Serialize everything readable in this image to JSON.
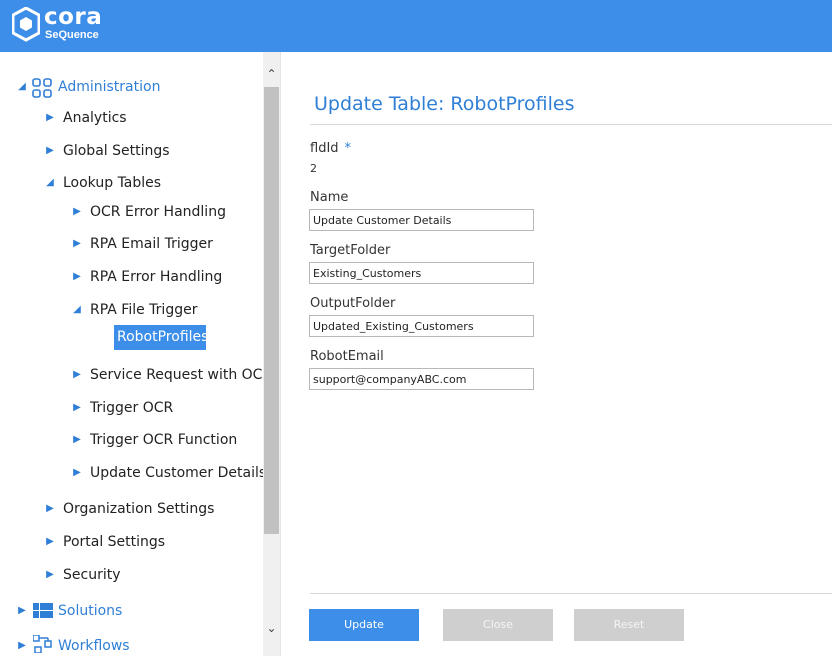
{
  "brand": {
    "name": "cora",
    "sub": "SeQuence"
  },
  "sidebar": {
    "administration": "Administration",
    "analytics": "Analytics",
    "global_settings": "Global Settings",
    "lookup_tables": "Lookup Tables",
    "ocr_error": "OCR Error Handling",
    "rpa_email": "RPA Email Trigger",
    "rpa_error": "RPA Error Handling",
    "rpa_file": "RPA File Trigger",
    "robot_profiles": "RobotProfiles",
    "service_request": "Service Request with OCR",
    "trigger_ocr": "Trigger OCR",
    "trigger_ocr_fn": "Trigger OCR Function",
    "update_customer": "Update Customer Details wi",
    "org_settings": "Organization Settings",
    "portal_settings": "Portal Settings",
    "security": "Security",
    "solutions": "Solutions",
    "workflows": "Workflows"
  },
  "form": {
    "title": "Update Table: RobotProfiles",
    "fldid_label": "fldId",
    "required_mark": "*",
    "fldid_value": "2",
    "name_label": "Name",
    "name_value": "Update Customer Details",
    "target_label": "TargetFolder",
    "target_value": "Existing_Customers",
    "output_label": "OutputFolder",
    "output_value": "Updated_Existing_Customers",
    "email_label": "RobotEmail",
    "email_value": "support@companyABC.com"
  },
  "buttons": {
    "update": "Update",
    "close": "Close",
    "reset": "Reset"
  },
  "colors": {
    "header": "#3c8ee8",
    "accent": "#2f7fd6",
    "disabled": "#cfcfcf"
  }
}
